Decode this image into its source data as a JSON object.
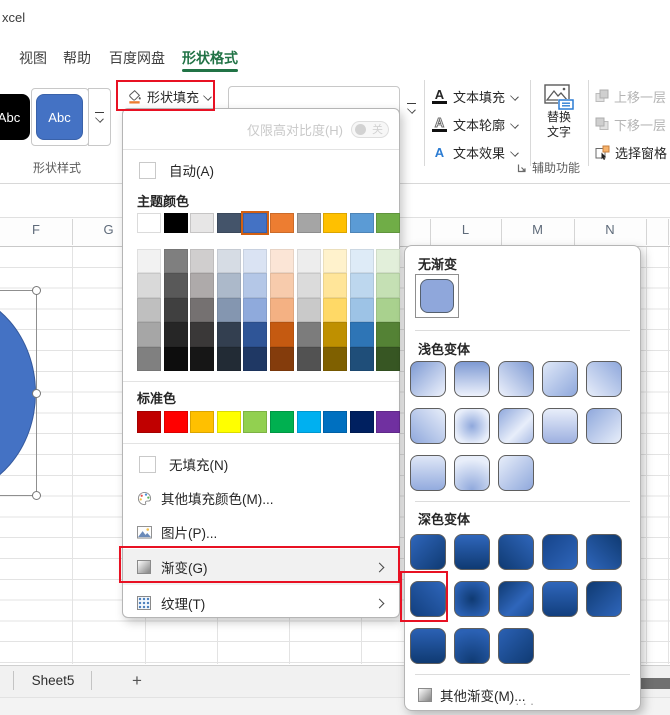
{
  "window": {
    "title_fragment": "xcel"
  },
  "ribbon": {
    "accent_green": "#217346",
    "tabs": [
      {
        "label": "视图",
        "active": false
      },
      {
        "label": "帮助",
        "active": false
      },
      {
        "label": "百度网盘",
        "active": false
      },
      {
        "label": "形状格式",
        "active": true
      }
    ],
    "shape_styles": {
      "group_label": "形状样式",
      "styles": [
        {
          "label": "Abc",
          "bg": "#000000"
        },
        {
          "label": "Abc",
          "bg": "#4472C4",
          "selected": true
        }
      ]
    },
    "shape_fill_button": {
      "label": "形状填充"
    },
    "text_buttons": [
      {
        "label": "文本填充"
      },
      {
        "label": "文本轮廓"
      },
      {
        "label": "文本效果"
      }
    ],
    "alt_text_button": {
      "line1": "替换",
      "line2": "文字"
    },
    "accessibility_group_label": "辅助功能",
    "arrange_buttons": [
      {
        "label": "上移一层",
        "disabled": true
      },
      {
        "label": "下移一层",
        "disabled": true
      },
      {
        "label": "选择窗格",
        "disabled": false
      }
    ]
  },
  "fill_menu": {
    "high_contrast": {
      "label": "仅限高对比度(H)",
      "toggle_state_label": "关"
    },
    "automatic_label": "自动(A)",
    "theme_colors": {
      "label": "主题颜色",
      "selected_index": 4,
      "top_row": [
        "#FFFFFF",
        "#000000",
        "#E7E6E6",
        "#44546A",
        "#4472C4",
        "#ED7D31",
        "#A5A5A5",
        "#FFC000",
        "#5B9BD5",
        "#70AD47"
      ],
      "variants": [
        [
          "#F2F2F2",
          "#D9D9D9",
          "#BFBFBF",
          "#A6A6A6",
          "#808080"
        ],
        [
          "#7F7F7F",
          "#595959",
          "#404040",
          "#262626",
          "#0D0D0D"
        ],
        [
          "#D0CECE",
          "#AEAAAA",
          "#757171",
          "#3A3838",
          "#161616"
        ],
        [
          "#D6DCE4",
          "#ACB9CA",
          "#8496B0",
          "#333F50",
          "#222B35"
        ],
        [
          "#DAE3F3",
          "#B4C7E7",
          "#8FAADC",
          "#2F5597",
          "#1F3864"
        ],
        [
          "#FBE5D6",
          "#F7CBAC",
          "#F4B183",
          "#C55A11",
          "#843C0C"
        ],
        [
          "#EDEDED",
          "#DBDBDB",
          "#C9C9C9",
          "#7C7C7C",
          "#525252"
        ],
        [
          "#FFF2CC",
          "#FFE599",
          "#FFD966",
          "#BF9000",
          "#7F6000"
        ],
        [
          "#DEEBF7",
          "#BDD7EE",
          "#9DC3E6",
          "#2E75B6",
          "#1F4E79"
        ],
        [
          "#E2EFDA",
          "#C5E0B4",
          "#A9D18E",
          "#548235",
          "#375623"
        ]
      ]
    },
    "standard_colors": {
      "label": "标准色",
      "colors": [
        "#C00000",
        "#FF0000",
        "#FFC000",
        "#FFFF00",
        "#92D050",
        "#00B050",
        "#00B0F0",
        "#0070C0",
        "#002060",
        "#7030A0"
      ]
    },
    "no_fill_label": "无填充(N)",
    "more_fill_colors_label": "其他填充颜色(M)...",
    "picture_label": "图片(P)...",
    "gradient_label": "渐变(G)",
    "texture_label": "纹理(T)"
  },
  "gradient_submenu": {
    "no_gradient": {
      "label": "无渐变",
      "swatch": "#8FA7DB"
    },
    "light_variants": {
      "label": "浅色变体",
      "swatches": [
        "linear-gradient(to bottom right,#7e9ad3,#eef2fc)",
        "linear-gradient(to bottom,#7e9ad3,#eef2fc)",
        "linear-gradient(to bottom left,#7e9ad3,#eef2fc)",
        "linear-gradient(to bottom right,#dfe8f8,#8fa8dc)",
        "linear-gradient(to top right,#e8eefa,#8fa8dc)",
        "linear-gradient(to bottom left,#e8eefa,#8fa8dc)",
        "radial-gradient(circle,#8fa8dc 0%,#e8eefa 75%)",
        "linear-gradient(to bottom right,#8fa8dc,#e8eefa 60%,#aabce5)",
        "linear-gradient(to bottom,#e8eefa,#9db0e0)",
        "linear-gradient(to top left,#e8eefa,#8fa8dc)",
        "linear-gradient(to bottom,#dfe7f7,#93abde)",
        "radial-gradient(circle at 50% 100%,#8fa8dc,#e8eefa 80%)",
        "linear-gradient(to bottom right,#e8eefa,#8fa8dc)"
      ]
    },
    "dark_variants": {
      "label": "深色变体",
      "highlighted_index": 5,
      "swatches": [
        "linear-gradient(to bottom right,#2f66bb,#0f3a72)",
        "linear-gradient(to bottom,#2f66bb,#0f3a72)",
        "linear-gradient(to bottom left,#2f66bb,#0f3a72)",
        "linear-gradient(to bottom right,#16448a,#2f66bb)",
        "linear-gradient(to top right,#2f66bb,#0f3a72)",
        "linear-gradient(to bottom left,#2f66bb,#123f7e)",
        "radial-gradient(circle,#0f3a72 0%,#2b61b4 80%)",
        "linear-gradient(to bottom right,#0f3a72,#2f66bb 60%,#1b4d94)",
        "linear-gradient(to bottom,#2f66bb,#123f7e)",
        "linear-gradient(to top left,#2f66bb,#0f3a72)",
        "linear-gradient(to bottom,#2b61b4,#0f3a72)",
        "radial-gradient(circle at 50% 100%,#0f3a72,#2b61b4 85%)",
        "linear-gradient(to bottom right,#2b61b4,#0f3a72)"
      ]
    },
    "more_gradients_label": "其他渐变(M)...",
    "resize_handle_dots": "····"
  },
  "worksheet": {
    "left_column_headers": [
      "F",
      "G"
    ],
    "right_column_headers": [
      "L",
      "M",
      "N"
    ],
    "shape_fill_color": "#4472C4"
  },
  "sheet_bar": {
    "sheet_tabs": [
      "Sheet5"
    ],
    "add_sheet_label": "+"
  },
  "annotation": {
    "color": "#E81123"
  }
}
